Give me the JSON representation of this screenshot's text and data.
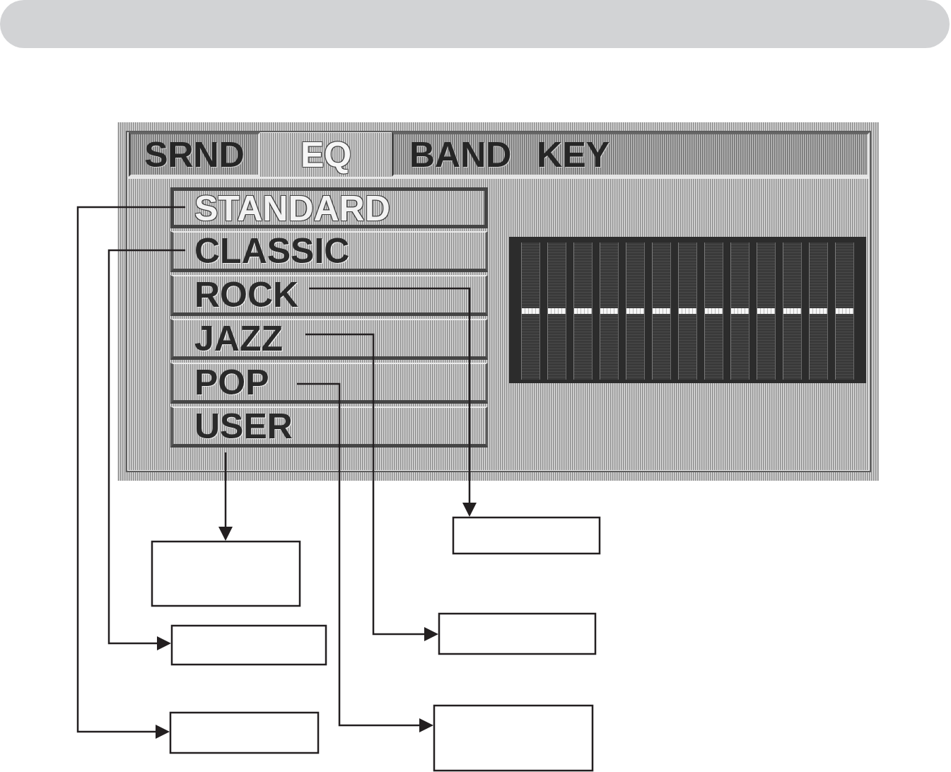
{
  "osd": {
    "tabs": [
      {
        "label": "SRND",
        "selected": false
      },
      {
        "label": "EQ",
        "selected": true
      },
      {
        "label": "BAND KEY",
        "selected": false
      }
    ],
    "presets": [
      {
        "label": "STANDARD",
        "selected": true
      },
      {
        "label": "CLASSIC",
        "selected": false
      },
      {
        "label": "ROCK",
        "selected": false
      },
      {
        "label": "JAZZ",
        "selected": false
      },
      {
        "label": "POP",
        "selected": false
      },
      {
        "label": "USER",
        "selected": false
      }
    ],
    "equalizer": {
      "bands": [
        {
          "level": 0.5
        },
        {
          "level": 0.5
        },
        {
          "level": 0.5
        },
        {
          "level": 0.5
        },
        {
          "level": 0.5
        },
        {
          "level": 0.5
        },
        {
          "level": 0.5
        },
        {
          "level": 0.5
        },
        {
          "level": 0.5
        },
        {
          "level": 0.5
        },
        {
          "level": 0.5
        },
        {
          "level": 0.5
        },
        {
          "level": 0.5
        }
      ]
    }
  }
}
